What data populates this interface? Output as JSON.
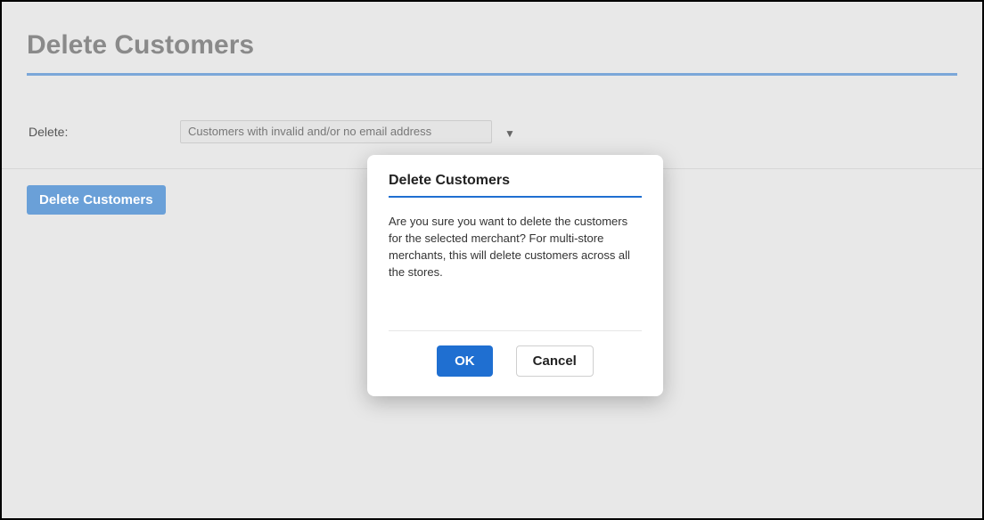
{
  "page": {
    "title": "Delete Customers"
  },
  "form": {
    "delete_label": "Delete:",
    "delete_select_value": "Customers with invalid and/or no email address"
  },
  "actions": {
    "delete_customers_label": "Delete Customers"
  },
  "modal": {
    "title": "Delete Customers",
    "body": "Are you sure you want to delete the customers for the selected merchant? For multi-store merchants, this will delete customers across all the stores.",
    "ok": "OK",
    "cancel": "Cancel"
  }
}
